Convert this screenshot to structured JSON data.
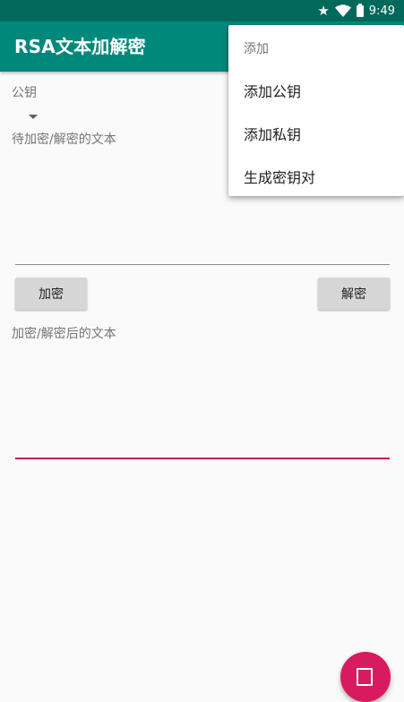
{
  "status_bar": {
    "time": "9:49",
    "icons": [
      "star-icon",
      "wifi-icon",
      "battery-icon"
    ],
    "color": "#00695c"
  },
  "app_bar": {
    "title": "RSA文本加解密",
    "color": "#00897b"
  },
  "form": {
    "public_key_label": "公钥",
    "input_hint": "待加密/解密的文本",
    "encrypt_button": "加密",
    "decrypt_button": "解密",
    "output_hint": "加密/解密后的文本"
  },
  "menu": {
    "header": "添加",
    "items": [
      {
        "label": "添加公钥"
      },
      {
        "label": "添加私钥"
      },
      {
        "label": "生成密钥对"
      }
    ]
  },
  "colors": {
    "accent": "#c2185b",
    "fab": "#d81b60"
  }
}
